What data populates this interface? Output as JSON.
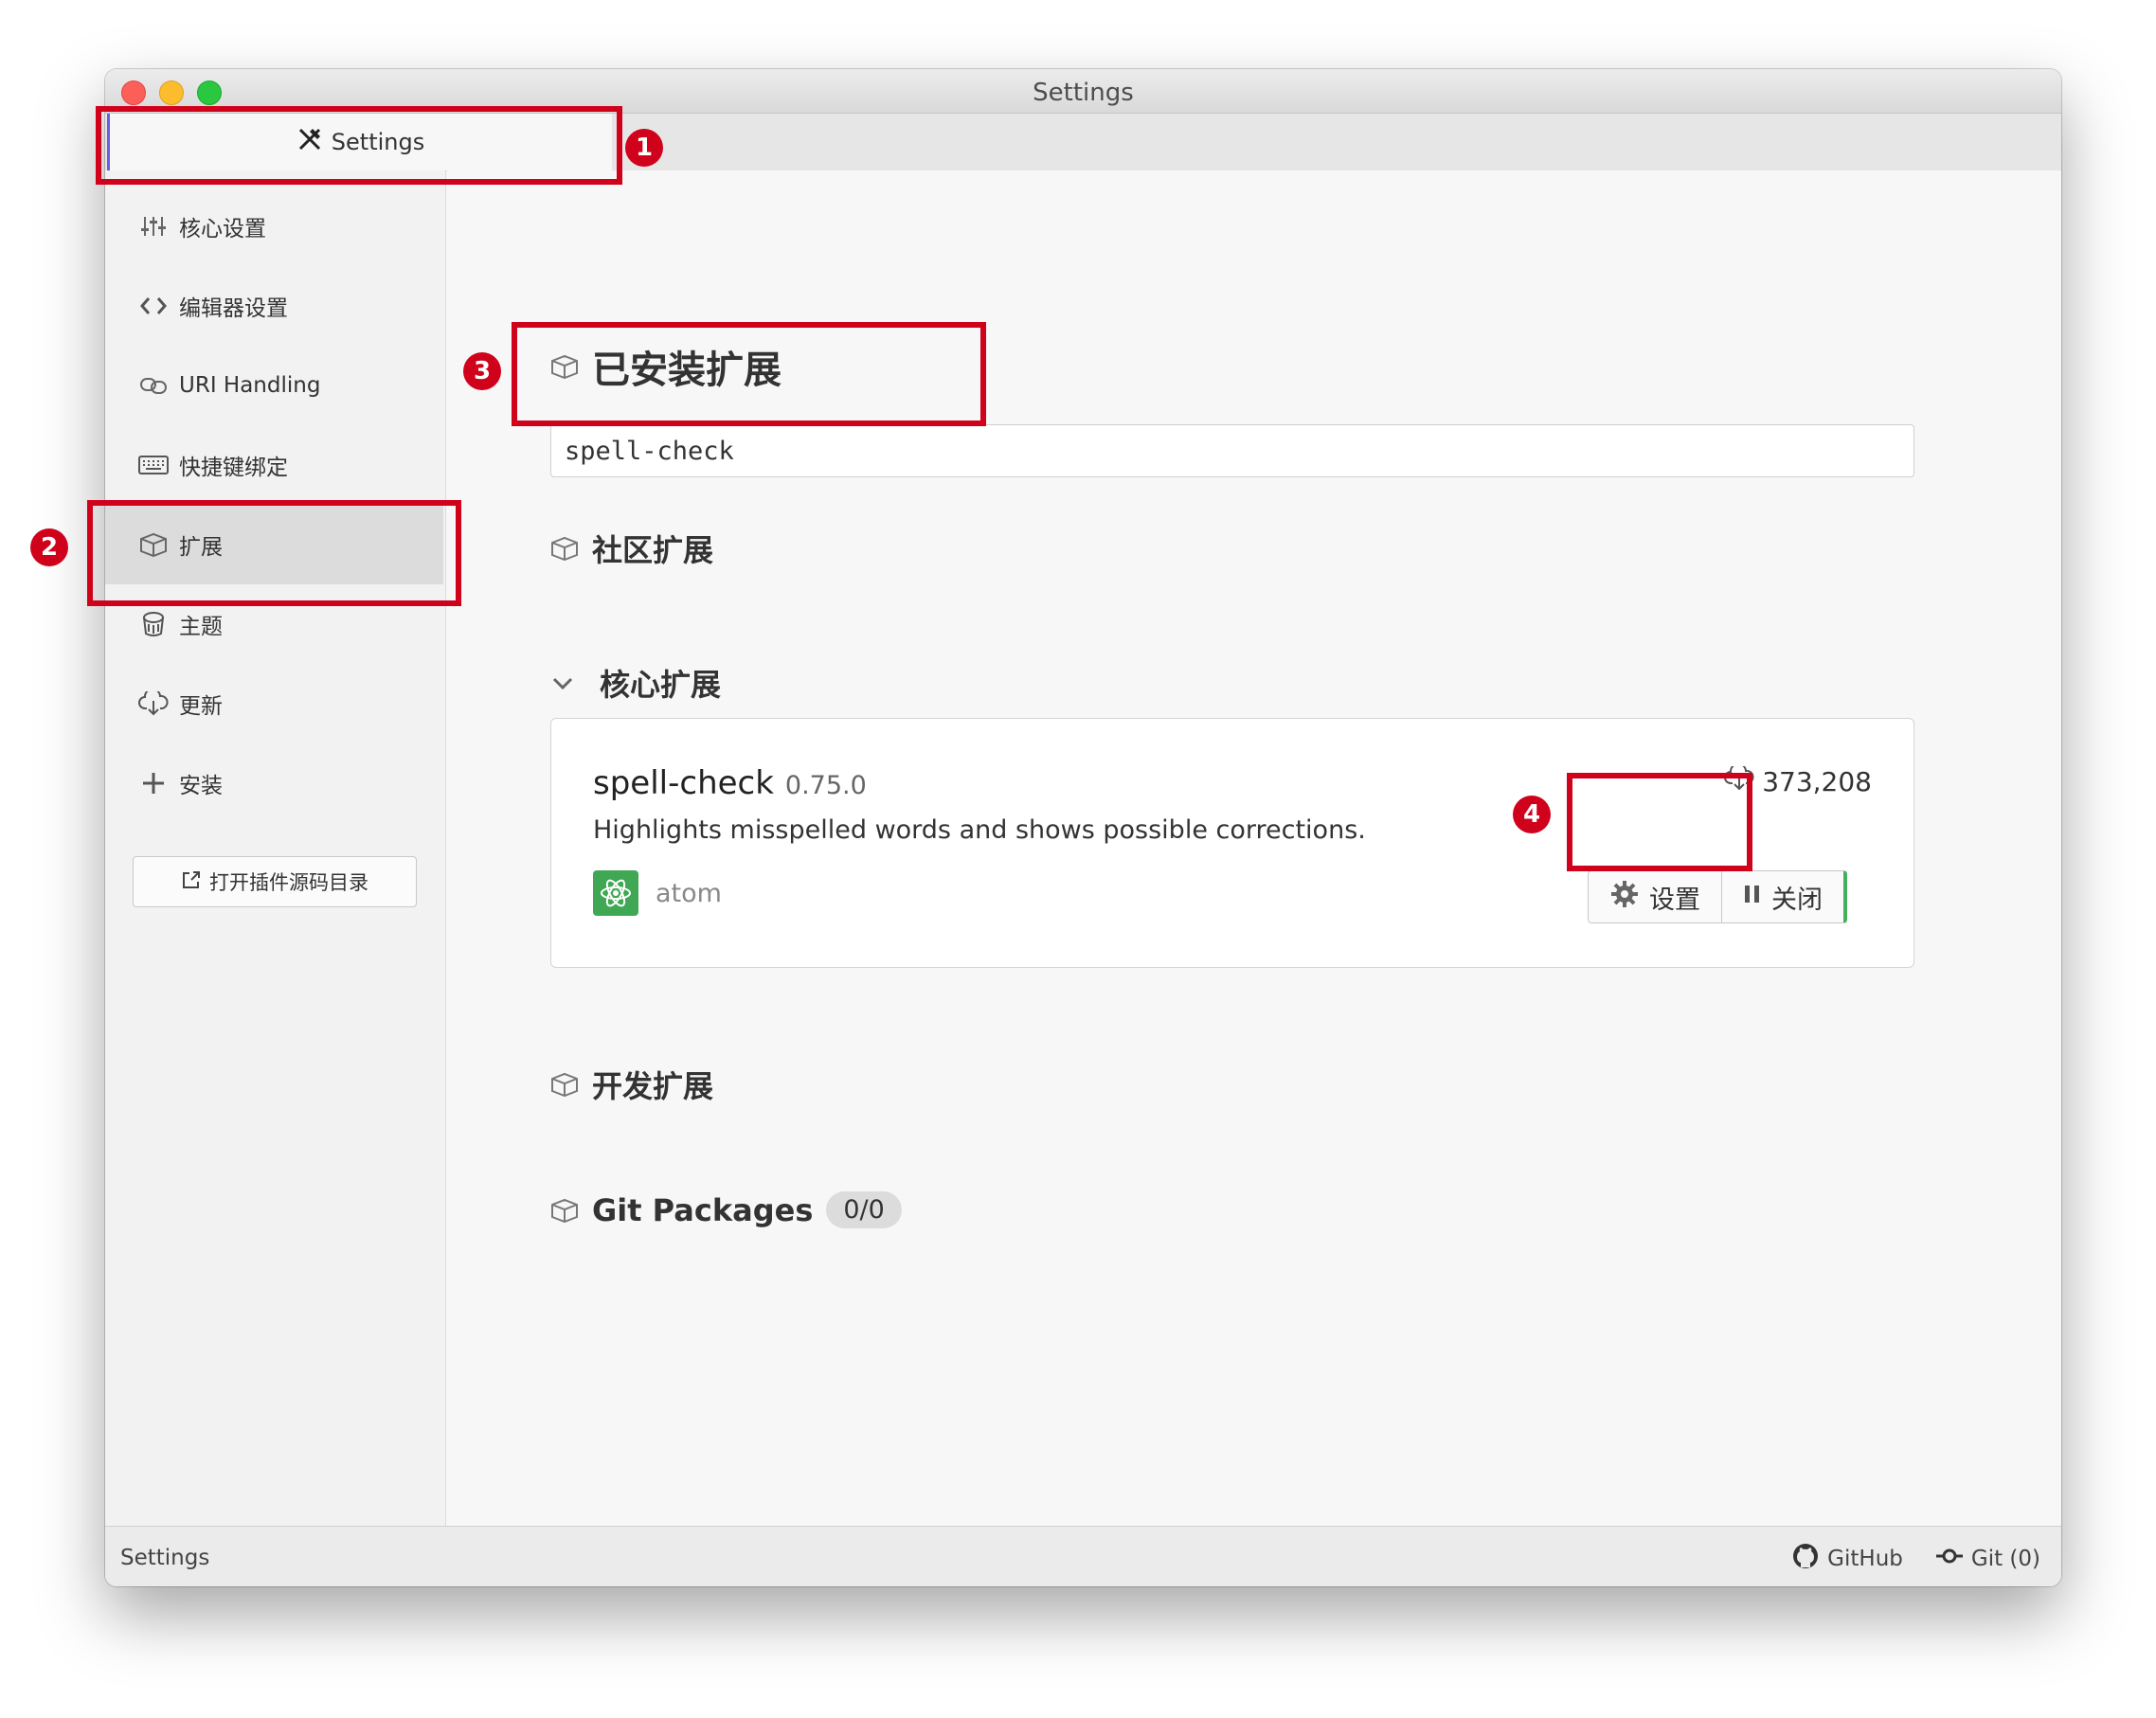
{
  "window": {
    "title": "Settings"
  },
  "tab": {
    "label": "Settings",
    "icon": "tools-icon"
  },
  "sidebar": {
    "items": [
      {
        "label": "核心设置",
        "icon": "sliders-icon"
      },
      {
        "label": "编辑器设置",
        "icon": "code-icon"
      },
      {
        "label": "URI Handling",
        "icon": "link-icon"
      },
      {
        "label": "快捷键绑定",
        "icon": "keyboard-icon"
      },
      {
        "label": "扩展",
        "icon": "package-icon",
        "active": true
      },
      {
        "label": "主题",
        "icon": "paintcan-icon"
      },
      {
        "label": "更新",
        "icon": "cloud-download-icon"
      },
      {
        "label": "安装",
        "icon": "plus-icon"
      }
    ],
    "open_dir_label": "打开插件源码目录"
  },
  "main": {
    "installed_title": "已安装扩展",
    "search_value": "spell-check",
    "community_title": "社区扩展",
    "core_title": "核心扩展",
    "package": {
      "name": "spell-check",
      "version": "0.75.0",
      "description": "Highlights misspelled words and shows possible corrections.",
      "downloads": "373,208",
      "author": "atom",
      "settings_label": "设置",
      "disable_label": "关闭"
    },
    "dev_title": "开发扩展",
    "git_title": "Git Packages",
    "git_count": "0/0"
  },
  "statusbar": {
    "left": "Settings",
    "github": "GitHub",
    "git": "Git (0)"
  },
  "annotations": [
    "1",
    "2",
    "3",
    "4"
  ],
  "colors": {
    "annotation": "#d0011b",
    "accent_green": "#43b05c",
    "tab_accent": "#6c5ce7"
  }
}
